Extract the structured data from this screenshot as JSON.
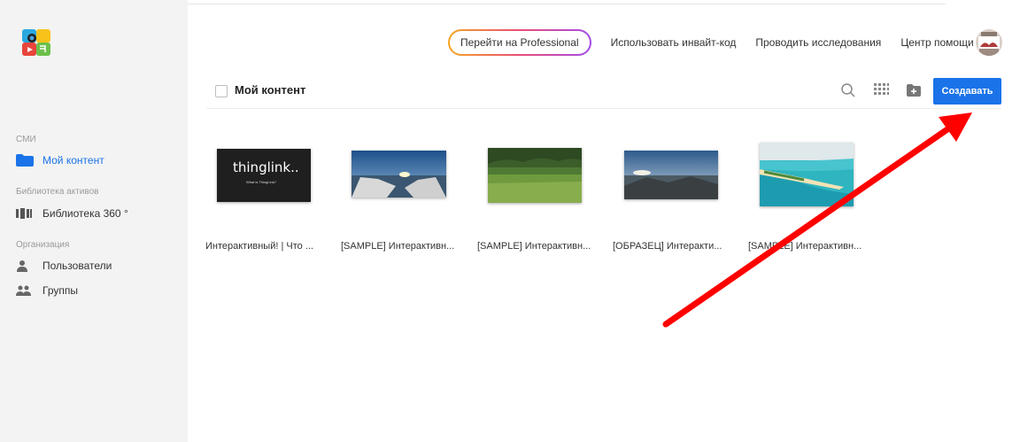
{
  "brand": {
    "accent": "#1a73e8",
    "sidebar_bg": "#f3f3f3",
    "annotation_color": "#ff0000"
  },
  "header": {
    "pro_button": "Перейти на Professional",
    "links": [
      "Использовать инвайт-код",
      "Проводить исследования",
      "Центр помощи"
    ]
  },
  "sidebar": {
    "section_media": "СМИ",
    "my_content": "Мой контент",
    "section_assets": "Библиотека активов",
    "library_360": "Библиотека 360 °",
    "section_org": "Организация",
    "users": "Пользователи",
    "groups": "Группы"
  },
  "toolbar": {
    "title": "Мой контент",
    "create_label": "Создавать",
    "icons": [
      "search-icon",
      "grid-view-icon",
      "add-folder-icon"
    ]
  },
  "cards": [
    {
      "label": "Интерактивный! | Что ...",
      "thumb_text": "thinglink..",
      "thumb_sub": "What is ThingLink?"
    },
    {
      "label": "[SAMPLE] Интерактивн..."
    },
    {
      "label": "[SAMPLE] Интерактивн..."
    },
    {
      "label": "[ОБРАЗЕЦ] Интеракти..."
    },
    {
      "label": "[SAMPLE] Интерактивн..."
    }
  ]
}
